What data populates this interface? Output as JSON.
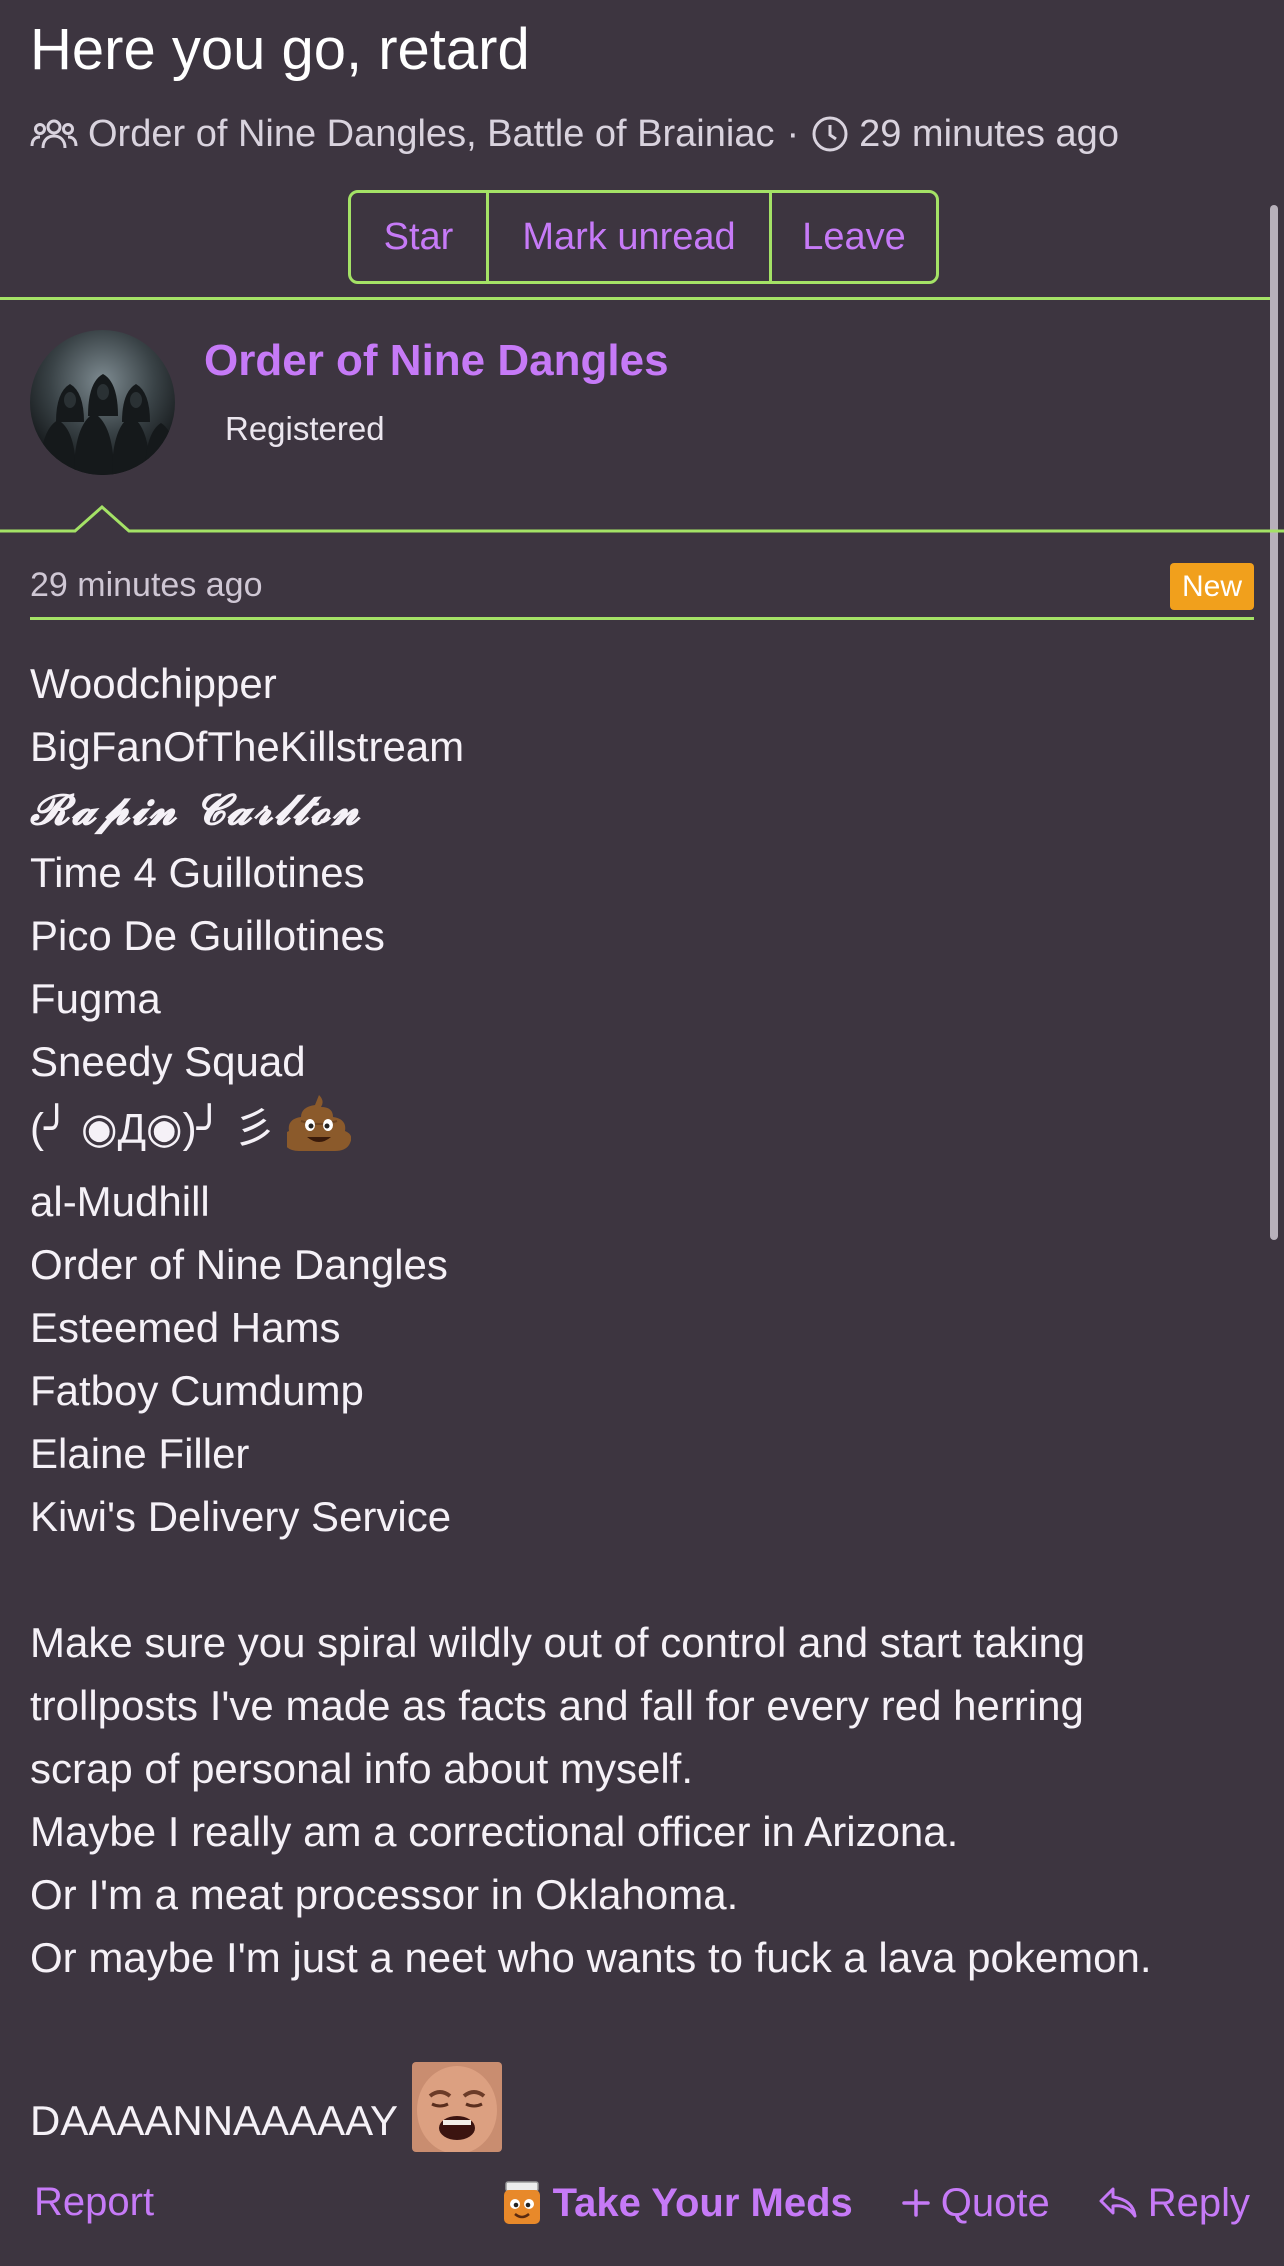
{
  "thread": {
    "title": "Here you go, retard",
    "participants": "Order of Nine Dangles, Battle of Brainiac",
    "separator": "·",
    "time": "29 minutes ago",
    "participants_icon": "users-icon",
    "time_icon": "clock-icon"
  },
  "actions": {
    "star": "Star",
    "mark_unread": "Mark unread",
    "leave": "Leave"
  },
  "author": {
    "name": "Order of Nine Dangles",
    "role": "Registered",
    "avatar": "hooded-figures-avatar"
  },
  "post": {
    "time": "29 minutes ago",
    "badge": "New",
    "lines": [
      "Woodchipper",
      "BigFanOfTheKillstream",
      "𝓡𝓪𝓹𝓲𝓷 𝓒𝓪𝓻𝓵𝓽𝓸𝓷",
      "Time 4 Guillotines",
      "Pico De Guillotines",
      "Fugma",
      "Sneedy Squad",
      "(╯ ◉Д◉)╯ 彡",
      "al-Mudhill",
      "Order of Nine Dangles",
      "Esteemed Hams",
      "Fatboy Cumdump",
      "Elaine Filler",
      "Kiwi's Delivery Service"
    ],
    "paragraph": [
      "Make sure you spiral wildly out of control and start taking",
      "trollposts I've made as facts and fall for every red herring",
      "scrap of personal info about myself.",
      "Maybe I really am a correctional officer in Arizona.",
      "Or I'm a meat processor in Oklahoma.",
      "Or maybe I'm just a neet who wants to fuck a lava pokemon."
    ],
    "closing": "DAAAANNAAAAAY",
    "closing_image": "crying-face-image",
    "emoji": "poop-emoji"
  },
  "footer": {
    "report": "Report",
    "meds": "Take Your Meds",
    "meds_icon": "pill-bottle-icon",
    "quote": "Quote",
    "quote_icon": "plus-icon",
    "reply": "Reply",
    "reply_icon": "reply-arrow-icon"
  },
  "colors": {
    "background": "#3d3540",
    "accent": "#c67af7",
    "rule": "#a4e266",
    "badge": "#f1a01c"
  }
}
